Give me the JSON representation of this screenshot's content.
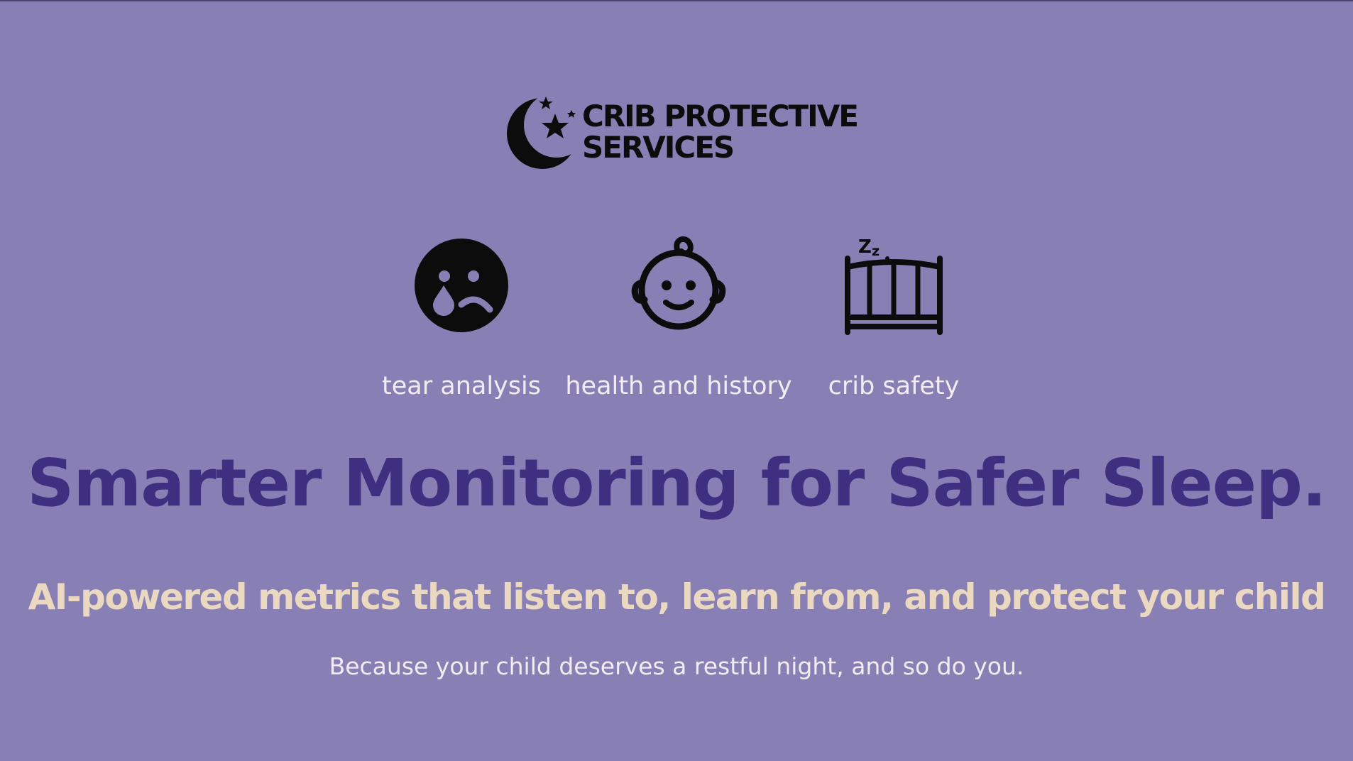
{
  "brand": {
    "name_line1": "CRIB PROTECTIVE",
    "name_line2": "SERVICES",
    "logo_icon": "moon-stars-icon"
  },
  "features": [
    {
      "label": "tear analysis",
      "icon": "crying-face-icon"
    },
    {
      "label": "health and history",
      "icon": "baby-face-icon"
    },
    {
      "label": "crib safety",
      "icon": "sleeping-crib-icon"
    }
  ],
  "hero": {
    "headline": "Smarter Monitoring for Safer Sleep.",
    "subheadline": "AI-powered metrics that listen to, learn from, and protect your child",
    "tagline": "Because your child deserves a restful night, and so do you."
  },
  "colors": {
    "background": "#8880b4",
    "headline": "#3e2f80",
    "subheadline": "#ead9c0",
    "body_text": "#f1ecf2",
    "icon": "#0c0c0c"
  }
}
